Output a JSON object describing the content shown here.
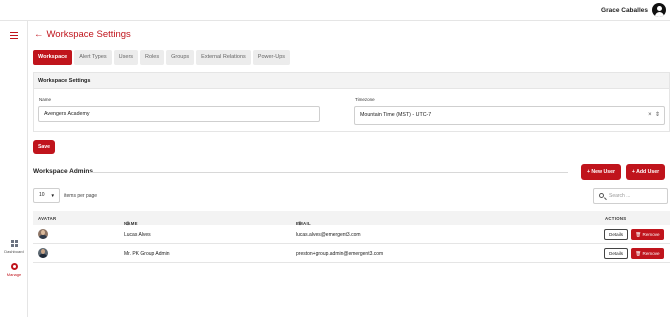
{
  "header": {
    "user_name": "Grace Caballes"
  },
  "sidebar": {
    "items": [
      {
        "label": "Dashboard"
      },
      {
        "label": "Manage"
      }
    ]
  },
  "page": {
    "title": "Workspace Settings",
    "back_symbol": "←"
  },
  "tabs": [
    {
      "label": "Workspace",
      "active": true
    },
    {
      "label": "Alert Types",
      "active": false
    },
    {
      "label": "Users",
      "active": false
    },
    {
      "label": "Roles",
      "active": false
    },
    {
      "label": "Groups",
      "active": false
    },
    {
      "label": "External Relations",
      "active": false
    },
    {
      "label": "Power-Ups",
      "active": false
    }
  ],
  "settings": {
    "section_title": "Workspace Settings",
    "name_label": "Name",
    "name_value": "Avengers Academy",
    "timezone_label": "Timezone",
    "timezone_value": "Mountain Time (MST) - UTC-7",
    "clear_symbol": "×",
    "save_label": "Save"
  },
  "admins": {
    "section_title": "Workspace Admins",
    "new_user_label": "+ New User",
    "add_user_label": "+ Add User",
    "per_page_value": "10",
    "per_page_text": "items per page",
    "search_placeholder": "Search ...",
    "columns": {
      "avatar": "AVATAR",
      "name": "NAME",
      "email": "EMAIL",
      "actions": "ACTIONS"
    },
    "details_label": "Details",
    "remove_label": "Remove",
    "rows": [
      {
        "name": "Lucas Alves",
        "email": "lucas.alves@emergent3.com"
      },
      {
        "name": "Mr. PK Group Admin",
        "email": "preston+group.admin@emergent3.com"
      }
    ]
  },
  "colors": {
    "accent": "#c0141c"
  }
}
